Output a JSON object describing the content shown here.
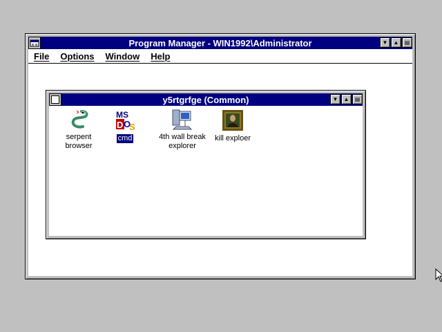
{
  "program_manager": {
    "title": "Program Manager - WIN1992\\Administrator",
    "menu": [
      "File",
      "Options",
      "Window",
      "Help"
    ],
    "buttons": {
      "minimize": "▼",
      "maximize": "▲",
      "restore": "▤"
    }
  },
  "group": {
    "title": "y5rtgrfge (Common)",
    "icons": [
      {
        "label_line1": "serpent",
        "label_line2": "browser",
        "icon": "snake-icon",
        "selected": false
      },
      {
        "label_line1": "cmd",
        "label_line2": "",
        "icon": "ms-dos-icon",
        "selected": true
      },
      {
        "label_line1": "4th wall break",
        "label_line2": "explorer",
        "icon": "computer-network-icon",
        "selected": false
      },
      {
        "label_line1": "kill exploer",
        "label_line2": "",
        "icon": "framed-portrait-icon",
        "selected": false
      }
    ]
  },
  "colors": {
    "titlebar": "#000080",
    "desktop": "#c0c0c0",
    "client": "#ffffff"
  }
}
